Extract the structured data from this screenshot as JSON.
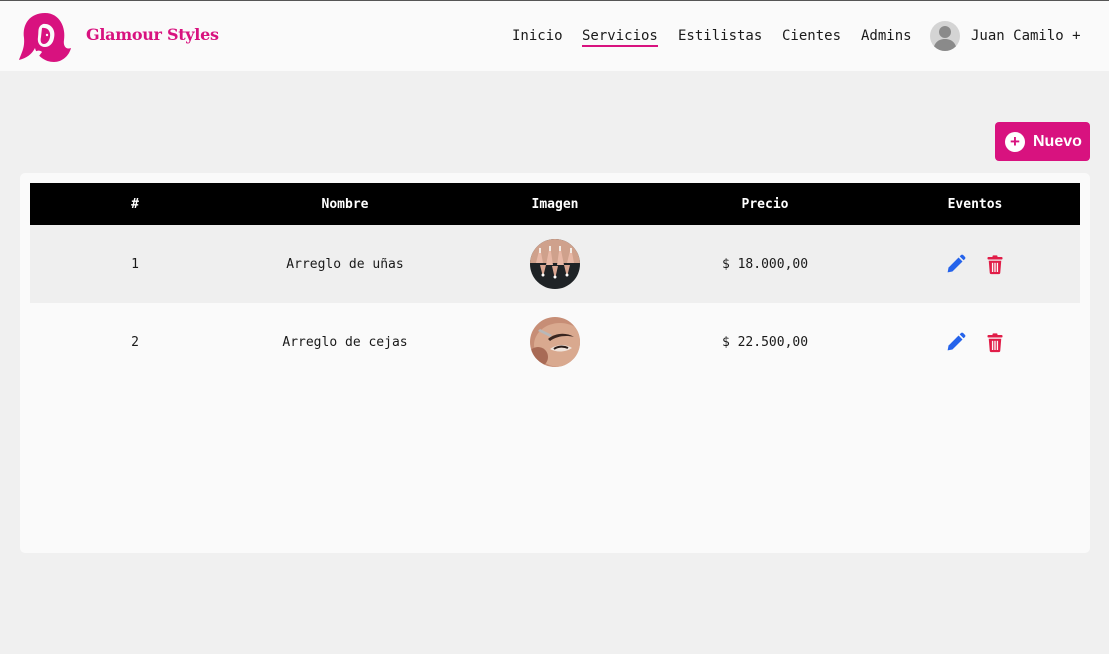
{
  "header": {
    "brand": "Glamour Styles",
    "nav": [
      "Inicio",
      "Servicios",
      "Estilistas",
      "Cientes",
      "Admins"
    ],
    "active_nav": "Servicios",
    "user": "Juan Camilo +"
  },
  "toolbar": {
    "new_label": "Nuevo"
  },
  "table": {
    "columns": [
      "#",
      "Nombre",
      "Imagen",
      "Precio",
      "Eventos"
    ],
    "rows": [
      {
        "num": "1",
        "name": "Arreglo de uñas",
        "image": "nails-photo",
        "price": "$ 18.000,00"
      },
      {
        "num": "2",
        "name": "Arreglo de cejas",
        "image": "eyebrows-photo",
        "price": "$ 22.500,00"
      }
    ]
  },
  "icons": [
    "woman-logo-icon",
    "user-avatar-icon",
    "plus-circle-icon",
    "pencil-icon",
    "trash-icon"
  ],
  "colors": {
    "accent": "#d8127f",
    "edit": "#2563eb",
    "delete": "#e11d48",
    "header_bg": "#000000"
  }
}
